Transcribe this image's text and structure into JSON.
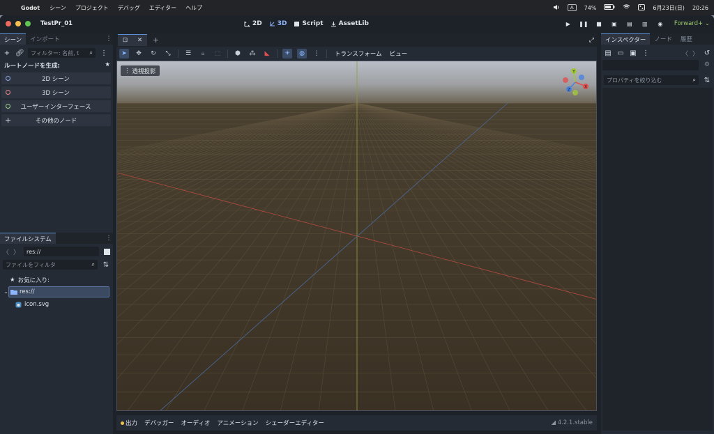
{
  "menubar": {
    "app": "Godot",
    "items": [
      "シーン",
      "プロジェクト",
      "デバッグ",
      "エディター",
      "ヘルプ"
    ],
    "input_mode": "A",
    "battery": "74%",
    "date": "6月23日(日)",
    "time": "20:26"
  },
  "window": {
    "project_title": "TestPr_01",
    "modes": [
      {
        "label": "2D",
        "icon": "2d-icon"
      },
      {
        "label": "3D",
        "icon": "3d-icon"
      },
      {
        "label": "Script",
        "icon": "script-icon"
      },
      {
        "label": "AssetLib",
        "icon": "assetlib-icon"
      }
    ],
    "active_mode": "3D",
    "renderer": "Forward+"
  },
  "scene_dock": {
    "tabs": [
      "シーン",
      "インポート"
    ],
    "filter_placeholder": "フィルター: 名前, t",
    "create_root_label": "ルートノードを生成:",
    "nodes": [
      {
        "label": "2D シーン",
        "color": "#8fa9e6"
      },
      {
        "label": "3D シーン",
        "color": "#e88a8a"
      },
      {
        "label": "ユーザーインターフェース",
        "color": "#9bd08a"
      },
      {
        "label": "その他のノード",
        "color": "#dfe3ea"
      }
    ]
  },
  "filesystem_dock": {
    "tab": "ファイルシステム",
    "path": "res://",
    "filter_placeholder": "ファイルをフィルタ",
    "favorites_label": "お気に入り:",
    "items": [
      {
        "label": "res://",
        "type": "folder"
      },
      {
        "label": "icon.svg",
        "type": "file"
      }
    ]
  },
  "viewport": {
    "view_mode_label": "透視投影",
    "toolbar_menus": [
      "トランスフォーム",
      "ビュー"
    ],
    "gizmo_axes": [
      "Y",
      "X",
      "Z"
    ],
    "colors": {
      "x_axis": "#e0504f",
      "y_axis": "#a2c83a",
      "z_axis": "#4a82e0"
    }
  },
  "inspector": {
    "tabs": [
      "インスペクター",
      "ノード",
      "履歴"
    ],
    "filter_placeholder": "プロパティを絞り込む"
  },
  "bottom_panel": {
    "tabs": [
      "出力",
      "デバッガー",
      "オーディオ",
      "アニメーション",
      "シェーダーエディター"
    ],
    "version": "4.2.1.stable"
  }
}
